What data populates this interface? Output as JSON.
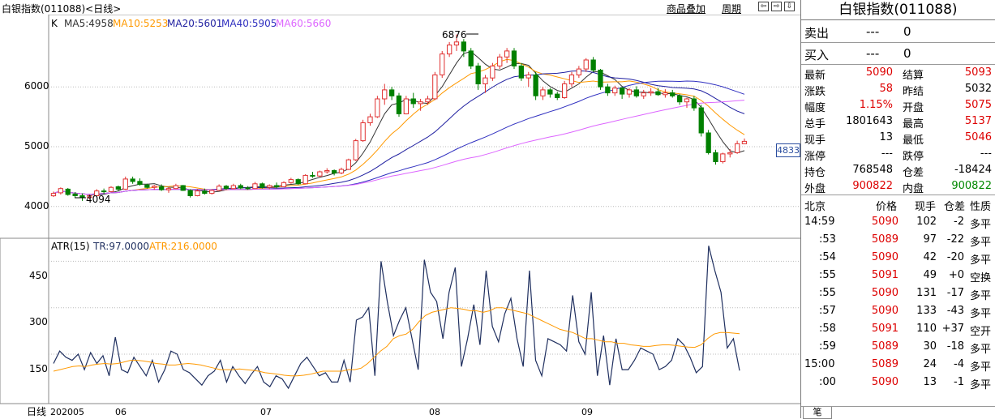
{
  "header": {
    "title": "白银指数(011088)<日线>",
    "link_overlay": "商品叠加",
    "link_period": "周期",
    "nav_buttons": [
      "⇦",
      "⇨",
      "⇩"
    ]
  },
  "main_legend": {
    "k": "K",
    "ma5": "MA5:4958",
    "ma10": "MA10:5253",
    "ma20": "MA20:5601",
    "ma40": "MA40:5905",
    "ma60": "MA60:5660"
  },
  "sub_legend": {
    "name": "ATR(15)",
    "tr": "TR:97.0000",
    "atr": "ATR:216.0000"
  },
  "axis": {
    "main_y_ticks": [
      "6000",
      "5000",
      "4000"
    ],
    "sub_y_ticks": [
      "450",
      "300",
      "150"
    ],
    "x_ticks": [
      "202005",
      "06",
      "07",
      "08",
      "09"
    ],
    "period_label": "日线",
    "price_marker": "4833",
    "high_annotation": "6876",
    "low_annotation": "4094"
  },
  "colors": {
    "up": "#e03030",
    "down": "#008000",
    "ma5": "#333333",
    "ma10": "#ff9900",
    "ma20": "#1f1fa0",
    "ma40": "#3030c0",
    "ma60": "#dd66ff",
    "tr": "#1f2f5f",
    "atr": "#ff9900"
  },
  "chart_data": [
    {
      "type": "candlestick",
      "title": "",
      "ylim": [
        3650,
        7000
      ],
      "x_labels": [
        "202005",
        "06",
        "07",
        "08",
        "09"
      ],
      "ohlc": [
        [
          4180,
          4250,
          4160,
          4220
        ],
        [
          4230,
          4320,
          4200,
          4300
        ],
        [
          4290,
          4310,
          4180,
          4200
        ],
        [
          4210,
          4240,
          4150,
          4180
        ],
        [
          4180,
          4220,
          4094,
          4150
        ],
        [
          4150,
          4200,
          4120,
          4180
        ],
        [
          4180,
          4290,
          4170,
          4260
        ],
        [
          4260,
          4300,
          4210,
          4250
        ],
        [
          4250,
          4340,
          4240,
          4320
        ],
        [
          4330,
          4350,
          4260,
          4290
        ],
        [
          4290,
          4500,
          4280,
          4460
        ],
        [
          4460,
          4500,
          4380,
          4420
        ],
        [
          4420,
          4470,
          4350,
          4370
        ],
        [
          4360,
          4380,
          4300,
          4320
        ],
        [
          4320,
          4360,
          4280,
          4340
        ],
        [
          4330,
          4370,
          4260,
          4280
        ],
        [
          4280,
          4330,
          4230,
          4300
        ],
        [
          4300,
          4380,
          4290,
          4350
        ],
        [
          4350,
          4360,
          4260,
          4270
        ],
        [
          4270,
          4290,
          4150,
          4180
        ],
        [
          4180,
          4290,
          4170,
          4260
        ],
        [
          4260,
          4300,
          4200,
          4220
        ],
        [
          4220,
          4290,
          4200,
          4270
        ],
        [
          4270,
          4370,
          4260,
          4340
        ],
        [
          4340,
          4360,
          4280,
          4300
        ],
        [
          4300,
          4380,
          4290,
          4350
        ],
        [
          4350,
          4380,
          4290,
          4310
        ],
        [
          4310,
          4340,
          4280,
          4300
        ],
        [
          4300,
          4410,
          4290,
          4380
        ],
        [
          4380,
          4400,
          4300,
          4320
        ],
        [
          4320,
          4370,
          4290,
          4350
        ],
        [
          4350,
          4400,
          4300,
          4330
        ],
        [
          4330,
          4420,
          4320,
          4400
        ],
        [
          4400,
          4480,
          4380,
          4450
        ],
        [
          4450,
          4470,
          4360,
          4380
        ],
        [
          4380,
          4540,
          4370,
          4520
        ],
        [
          4520,
          4580,
          4480,
          4510
        ],
        [
          4510,
          4600,
          4490,
          4580
        ],
        [
          4580,
          4640,
          4550,
          4600
        ],
        [
          4600,
          4620,
          4520,
          4560
        ],
        [
          4560,
          4650,
          4540,
          4620
        ],
        [
          4620,
          4800,
          4610,
          4780
        ],
        [
          4780,
          5130,
          4760,
          5100
        ],
        [
          5100,
          5450,
          5080,
          5400
        ],
        [
          5400,
          5550,
          5350,
          5500
        ],
        [
          5500,
          5850,
          5480,
          5800
        ],
        [
          5800,
          6050,
          5700,
          5950
        ],
        [
          5950,
          6000,
          5780,
          5850
        ],
        [
          5850,
          5900,
          5500,
          5550
        ],
        [
          5550,
          5850,
          5540,
          5800
        ],
        [
          5800,
          5900,
          5650,
          5720
        ],
        [
          5720,
          5800,
          5600,
          5750
        ],
        [
          5750,
          5850,
          5700,
          5800
        ],
        [
          5800,
          6250,
          5780,
          6200
        ],
        [
          6200,
          6600,
          6150,
          6550
        ],
        [
          6550,
          6750,
          6500,
          6700
        ],
        [
          6700,
          6876,
          6600,
          6750
        ],
        [
          6750,
          6800,
          6500,
          6600
        ],
        [
          6600,
          6650,
          6300,
          6350
        ],
        [
          6350,
          6400,
          5950,
          6050
        ],
        [
          6050,
          6200,
          5900,
          6150
        ],
        [
          6150,
          6400,
          6100,
          6350
        ],
        [
          6350,
          6550,
          6300,
          6500
        ],
        [
          6500,
          6650,
          6400,
          6600
        ],
        [
          6600,
          6650,
          6300,
          6350
        ],
        [
          6350,
          6400,
          6100,
          6150
        ],
        [
          6150,
          6250,
          6000,
          6200
        ],
        [
          6200,
          6250,
          5780,
          5850
        ],
        [
          5850,
          6000,
          5780,
          5950
        ],
        [
          5950,
          5980,
          5820,
          5880
        ],
        [
          5880,
          5920,
          5780,
          5820
        ],
        [
          5820,
          6100,
          5800,
          6050
        ],
        [
          6050,
          6250,
          6000,
          6200
        ],
        [
          6200,
          6350,
          6150,
          6300
        ],
        [
          6300,
          6480,
          6250,
          6450
        ],
        [
          6450,
          6500,
          6250,
          6280
        ],
        [
          6280,
          6300,
          5950,
          6000
        ],
        [
          6000,
          6050,
          5850,
          5900
        ],
        [
          5900,
          6020,
          5850,
          5980
        ],
        [
          5980,
          6000,
          5800,
          5880
        ],
        [
          5880,
          5980,
          5820,
          5950
        ],
        [
          5950,
          6010,
          5820,
          5850
        ],
        [
          5850,
          5950,
          5800,
          5900
        ],
        [
          5900,
          5980,
          5850,
          5920
        ],
        [
          5920,
          5980,
          5850,
          5870
        ],
        [
          5870,
          5960,
          5820,
          5900
        ],
        [
          5900,
          5950,
          5820,
          5850
        ],
        [
          5850,
          5880,
          5700,
          5750
        ],
        [
          5750,
          5820,
          5650,
          5800
        ],
        [
          5800,
          5850,
          5600,
          5650
        ],
        [
          5650,
          5700,
          5170,
          5230
        ],
        [
          5230,
          5280,
          4870,
          4900
        ],
        [
          4900,
          4950,
          4700,
          4750
        ],
        [
          4750,
          4900,
          4720,
          4880
        ],
        [
          4880,
          4960,
          4820,
          4900
        ],
        [
          4900,
          5100,
          4880,
          5050
        ],
        [
          5050,
          5137,
          5046,
          5090
        ]
      ],
      "ma_series_names": [
        "MA5",
        "MA10",
        "MA20",
        "MA40",
        "MA60"
      ]
    },
    {
      "type": "line",
      "title": "",
      "ylim": [
        20,
        520
      ],
      "series": [
        {
          "name": "TR",
          "values": [
            120,
            160,
            140,
            130,
            150,
            100,
            155,
            120,
            145,
            80,
            205,
            100,
            90,
            140,
            110,
            80,
            130,
            60,
            100,
            160,
            150,
            100,
            90,
            70,
            50,
            80,
            95,
            130,
            60,
            110,
            80,
            55,
            85,
            110,
            60,
            45,
            80,
            70,
            40,
            80,
            120,
            140,
            110,
            80,
            90,
            60,
            60,
            130,
            60,
            260,
            270,
            300,
            80,
            450,
            320,
            210,
            260,
            300,
            200,
            100,
            455,
            350,
            320,
            200,
            350,
            430,
            110,
            200,
            310,
            180,
            420,
            240,
            190,
            280,
            330,
            200,
            110,
            420,
            130,
            80,
            200,
            190,
            180,
            160,
            340,
            190,
            150,
            350,
            80,
            210,
            50,
            200,
            100,
            100,
            130,
            170,
            160,
            150,
            100,
            110,
            130,
            200,
            180,
            140,
            90,
            110,
            500,
            420,
            350,
            170,
            200,
            97
          ]
        }
      ],
      "atr_values": [
        95,
        100,
        105,
        110,
        112,
        110,
        115,
        118,
        120,
        118,
        120,
        125,
        130,
        130,
        128,
        125,
        120,
        118,
        115,
        115,
        118,
        120,
        118,
        115,
        110,
        105,
        100,
        100,
        100,
        102,
        100,
        98,
        95,
        90,
        88,
        85,
        82,
        80,
        80,
        82,
        85,
        90,
        95,
        95,
        95,
        95,
        100,
        100,
        105,
        120,
        140,
        160,
        175,
        200,
        210,
        215,
        230,
        255,
        275,
        285,
        290,
        295,
        300,
        298,
        295,
        290,
        290,
        285,
        290,
        300,
        300,
        295,
        290,
        285,
        280,
        270,
        260,
        250,
        240,
        230,
        225,
        220,
        210,
        200,
        200,
        195,
        190,
        190,
        185,
        185,
        180,
        178,
        175,
        175,
        178,
        180,
        180,
        178,
        175,
        173,
        172,
        180,
        200,
        215,
        220,
        220,
        218,
        216
      ]
    }
  ],
  "quote_panel": {
    "title": "白银指数(011088)",
    "sell_label": "卖出",
    "sell_price": "---",
    "sell_qty": "0",
    "buy_label": "买入",
    "buy_price": "---",
    "buy_qty": "0",
    "rows": [
      {
        "l1": "最新",
        "v1": "5090",
        "l2": "结算",
        "v2": "5093"
      },
      {
        "l1": "涨跌",
        "v1": "58",
        "l2": "昨结",
        "v2": "5032"
      },
      {
        "l1": "幅度",
        "v1": "1.15%",
        "l2": "开盘",
        "v2": "5075"
      },
      {
        "l1": "总手",
        "v1": "1801643",
        "l2": "最高",
        "v2": "5137"
      },
      {
        "l1": "现手",
        "v1": "13",
        "l2": "最低",
        "v2": "5046"
      },
      {
        "l1": "涨停",
        "v1": "---",
        "l2": "跌停",
        "v2": "---"
      },
      {
        "l1": "持仓",
        "v1": "768548",
        "l2": "仓差",
        "v2": "-18424"
      },
      {
        "l1": "外盘",
        "v1": "900822",
        "l2": "内盘",
        "v2": "900822"
      }
    ],
    "trade_header": [
      "北京",
      "价格",
      "现手",
      "仓差",
      "性质"
    ],
    "trades": [
      {
        "t": "14:59",
        "p": "5090",
        "q": "102",
        "d": "-2",
        "n": "多平"
      },
      {
        "t": ":53",
        "p": "5089",
        "q": "97",
        "d": "-22",
        "n": "多平"
      },
      {
        "t": ":54",
        "p": "5090",
        "q": "42",
        "d": "-20",
        "n": "多平"
      },
      {
        "t": ":55",
        "p": "5091",
        "q": "49",
        "d": "+0",
        "n": "空换"
      },
      {
        "t": ":55",
        "p": "5090",
        "q": "131",
        "d": "-17",
        "n": "多平"
      },
      {
        "t": ":57",
        "p": "5090",
        "q": "133",
        "d": "-43",
        "n": "多平"
      },
      {
        "t": ":58",
        "p": "5091",
        "q": "110",
        "d": "+37",
        "n": "空开"
      },
      {
        "t": ":59",
        "p": "5089",
        "q": "30",
        "d": "-18",
        "n": "多平"
      },
      {
        "t": "15:00",
        "p": "5089",
        "q": "24",
        "d": "-4",
        "n": "多平"
      },
      {
        "t": ":00",
        "p": "5090",
        "q": "13",
        "d": "-1",
        "n": "多平"
      }
    ],
    "foot_tab": "笔"
  }
}
